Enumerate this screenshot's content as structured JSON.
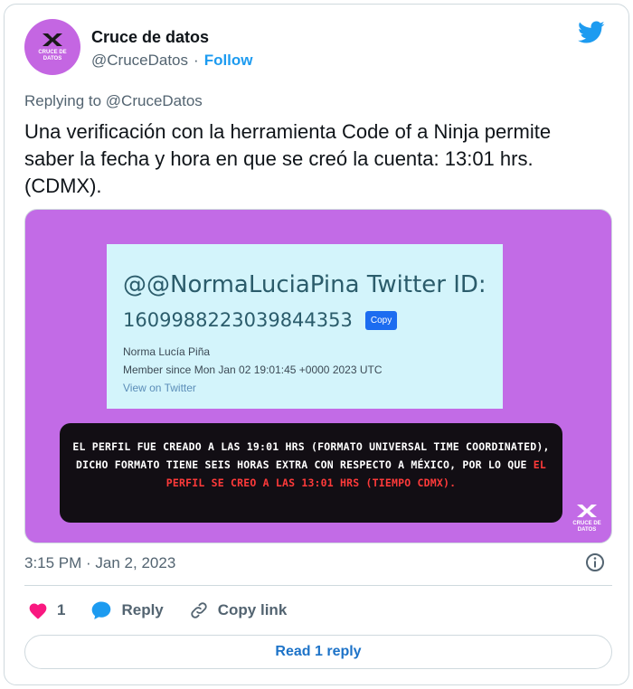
{
  "author": {
    "name": "Cruce de datos",
    "handle": "@CruceDatos",
    "separator": "·",
    "follow_label": "Follow",
    "avatar_text": "CRUCE DE DATOS"
  },
  "replying": {
    "prefix": "Replying to",
    "mention": "@CruceDatos"
  },
  "tweet_text": "Una verificación con la herramienta Code of a Ninja permite saber la fecha y hora en que se creó la cuenta: 13:01 hrs. (CDMX).",
  "media": {
    "ninja": {
      "title": "@@NormaLuciaPina Twitter ID:",
      "id": "1609988223039844353",
      "copy_label": "Copy",
      "name": "Norma Lucía Piña",
      "member_since": "Member since Mon Jan 02 19:01:45 +0000 2023 UTC",
      "view_link": "View on Twitter"
    },
    "notice": {
      "text_white": "EL PERFIL FUE CREADO A LAS 19:01 HRS (FORMATO UNIVERSAL TIME COORDINATED), DICHO FORMATO TIENE SEIS HORAS EXTRA CON RESPECTO A MÉXICO, POR LO QUE ",
      "text_red": "EL PERFIL SE CREO A LAS 13:01 HRS (TIEMPO CDMX)."
    },
    "watermark_text": "CRUCE DE DATOS"
  },
  "timestamp": "3:15 PM · Jan 2, 2023",
  "actions": {
    "like_count": "1",
    "reply_label": "Reply",
    "copy_link_label": "Copy link"
  },
  "read_reply_label": "Read 1 reply",
  "colors": {
    "accent": "#1d9bf0",
    "like": "#f91880",
    "media_bg": "#c26be6",
    "ninja_bg": "#d3f4fb",
    "notice_bg": "#120e14",
    "notice_highlight": "#ff3a3a"
  },
  "icons": [
    "crossing-logo-icon",
    "twitter-bird-icon",
    "info-icon",
    "heart-icon",
    "reply-bubble-icon",
    "link-icon"
  ]
}
